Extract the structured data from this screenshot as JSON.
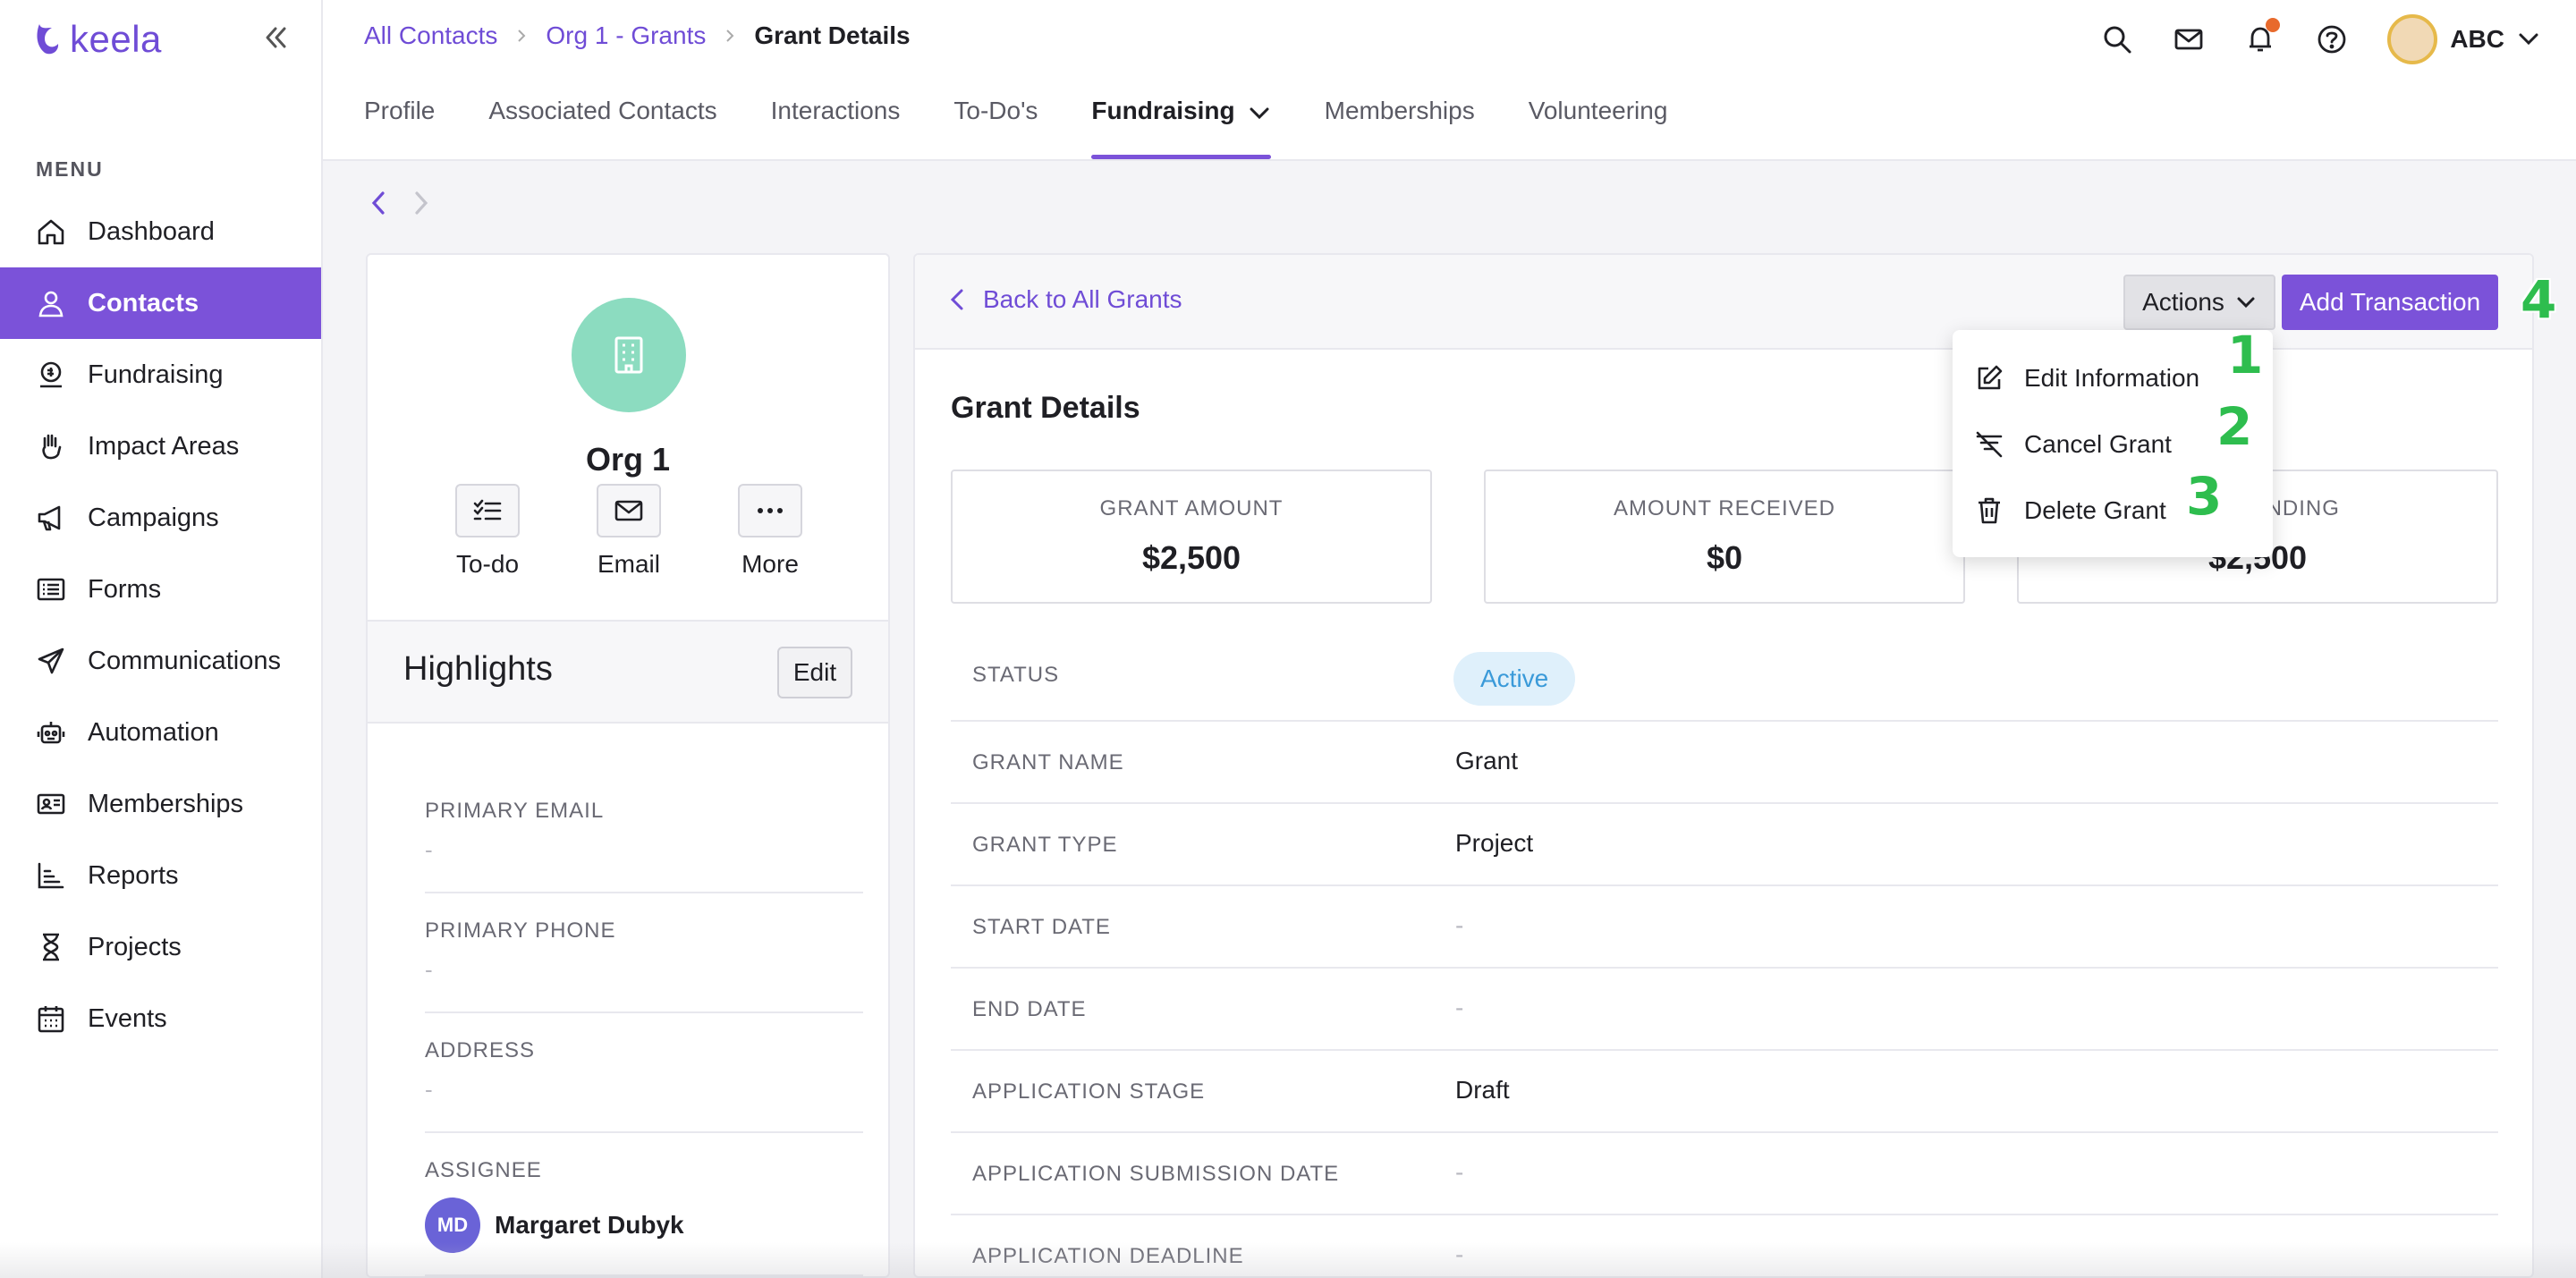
{
  "app": {
    "logo_text": "keela"
  },
  "sidebar": {
    "menu_label": "MENU",
    "items": [
      {
        "label": "Dashboard",
        "icon": "home-icon"
      },
      {
        "label": "Contacts",
        "icon": "person-icon",
        "active": true
      },
      {
        "label": "Fundraising",
        "icon": "donation-icon"
      },
      {
        "label": "Impact Areas",
        "icon": "hand-icon"
      },
      {
        "label": "Campaigns",
        "icon": "megaphone-icon"
      },
      {
        "label": "Forms",
        "icon": "form-icon"
      },
      {
        "label": "Communications",
        "icon": "paper-plane-icon"
      },
      {
        "label": "Automation",
        "icon": "robot-icon"
      },
      {
        "label": "Memberships",
        "icon": "id-card-icon"
      },
      {
        "label": "Reports",
        "icon": "bar-chart-icon"
      },
      {
        "label": "Projects",
        "icon": "hourglass-icon"
      },
      {
        "label": "Events",
        "icon": "calendar-icon"
      }
    ]
  },
  "breadcrumb": {
    "items": [
      "All Contacts",
      "Org 1 - Grants",
      "Grant Details"
    ]
  },
  "header": {
    "user_name": "ABC"
  },
  "tabs": [
    "Profile",
    "Associated Contacts",
    "Interactions",
    "To-Do's",
    "Fundraising",
    "Memberships",
    "Volunteering"
  ],
  "profile": {
    "org_name": "Org 1",
    "quick_actions": [
      "To-do",
      "Email",
      "More"
    ],
    "highlights_title": "Highlights",
    "edit_label": "Edit",
    "fields": [
      {
        "label": "PRIMARY EMAIL",
        "value": "-"
      },
      {
        "label": "PRIMARY PHONE",
        "value": "-"
      },
      {
        "label": "ADDRESS",
        "value": "-"
      }
    ],
    "assignee": {
      "label": "ASSIGNEE",
      "initials": "MD",
      "name": "Margaret Dubyk"
    }
  },
  "grant": {
    "back_label": "Back to All Grants",
    "actions_label": "Actions",
    "add_transaction_label": "Add Transaction",
    "title": "Grant Details",
    "stats": [
      {
        "label": "GRANT AMOUNT",
        "value": "$2,500"
      },
      {
        "label": "AMOUNT RECEIVED",
        "value": "$0"
      },
      {
        "label": "OUTSTANDING",
        "value": "$2,500"
      }
    ],
    "status": {
      "label": "STATUS",
      "value": "Active"
    },
    "rows": [
      {
        "label": "GRANT NAME",
        "value": "Grant"
      },
      {
        "label": "GRANT TYPE",
        "value": "Project"
      },
      {
        "label": "START DATE",
        "value": "-"
      },
      {
        "label": "END DATE",
        "value": "-"
      },
      {
        "label": "APPLICATION STAGE",
        "value": "Draft"
      },
      {
        "label": "APPLICATION SUBMISSION DATE",
        "value": "-"
      },
      {
        "label": "APPLICATION DEADLINE",
        "value": "-"
      }
    ]
  },
  "actions_menu": {
    "items": [
      "Edit Information",
      "Cancel Grant",
      "Delete Grant"
    ]
  },
  "annotations": [
    "1",
    "2",
    "3",
    "4"
  ],
  "colors": {
    "accent": "#7b52d9",
    "status_bg": "#dff0fb",
    "status_text": "#3a9ad9",
    "annotation": "#2ebd4e"
  }
}
